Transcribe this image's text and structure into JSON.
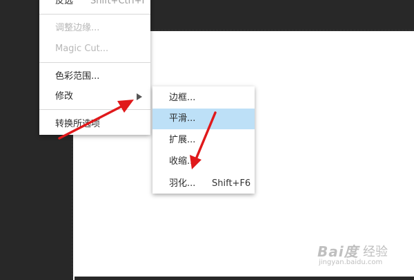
{
  "main_menu": {
    "items": [
      {
        "label": "反选",
        "shortcut": "Shift+Ctrl+I"
      },
      {
        "label": "调整边缘..."
      },
      {
        "label": "Magic Cut..."
      },
      {
        "label": "色彩范围..."
      },
      {
        "label": "修改"
      },
      {
        "label": "转换所选项"
      }
    ]
  },
  "submenu": {
    "items": [
      {
        "label": "边框..."
      },
      {
        "label": "平滑..."
      },
      {
        "label": "扩展..."
      },
      {
        "label": "收缩..."
      },
      {
        "label": "羽化...",
        "shortcut": "Shift+F6"
      }
    ]
  },
  "watermark": {
    "logo": "Bai度",
    "suffix": "经验",
    "url": "jingyan.baidu.com"
  },
  "colors": {
    "workspace": "#282828",
    "menu_bg": "#ffffff",
    "highlight": "#bde0f7",
    "annotation_arrow": "#e0191b"
  }
}
